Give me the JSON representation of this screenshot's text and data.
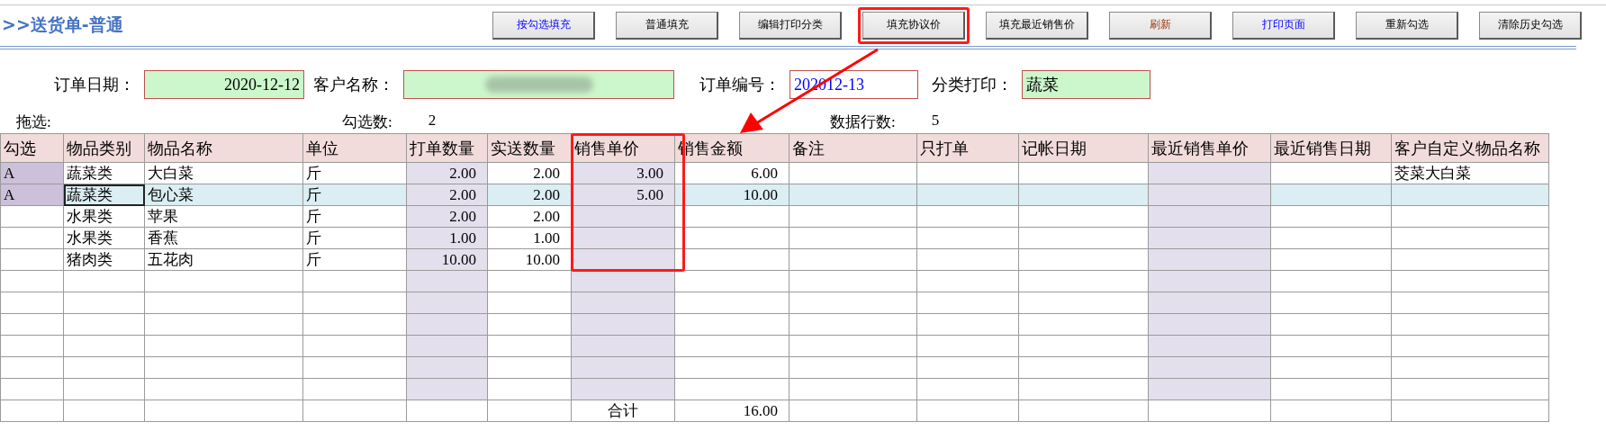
{
  "title": ">>送货单-普通",
  "buttons": [
    {
      "label": "按勾选填充",
      "kind": "link",
      "highlighted": false
    },
    {
      "label": "普通填充",
      "kind": "plain",
      "highlighted": false
    },
    {
      "label": "编辑打印分类",
      "kind": "plain",
      "highlighted": false
    },
    {
      "label": "填充协议价",
      "kind": "plain",
      "highlighted": true
    },
    {
      "label": "填充最近销售价",
      "kind": "plain",
      "highlighted": false
    },
    {
      "label": "刷新",
      "kind": "warning",
      "highlighted": false
    },
    {
      "label": "打印页面",
      "kind": "link",
      "highlighted": false
    },
    {
      "label": "重新勾选",
      "kind": "plain",
      "highlighted": false
    },
    {
      "label": "清除历史勾选",
      "kind": "plain",
      "highlighted": false
    }
  ],
  "fields": [
    {
      "label": "订单日期：",
      "kind": "date",
      "value": "2020-12-12"
    },
    {
      "label": "客户名称：",
      "kind": "blurred",
      "value_blurred": true
    },
    {
      "label": "订单编号：",
      "kind": "code",
      "value": "202012-13"
    },
    {
      "label": "分类打印：",
      "kind": "text",
      "value": "蔬菜"
    }
  ],
  "summary": [
    {
      "label": "拖选:"
    },
    {
      "label": "勾选数:",
      "value": "2"
    },
    {
      "label": "数据行数:",
      "value": "5"
    }
  ],
  "table": {
    "columns": [
      {
        "label": "勾选",
        "kind": "check",
        "shaded": false,
        "highlighted": false
      },
      {
        "label": "物品类别",
        "kind": "text",
        "shaded": false,
        "highlighted": false
      },
      {
        "label": "物品名称",
        "kind": "text",
        "shaded": false,
        "highlighted": false
      },
      {
        "label": "单位",
        "kind": "text",
        "shaded": false,
        "highlighted": false
      },
      {
        "label": "打单数量",
        "kind": "number",
        "shaded": true,
        "highlighted": false
      },
      {
        "label": "实送数量",
        "kind": "number",
        "shaded": false,
        "highlighted": false
      },
      {
        "label": "销售单价",
        "kind": "number",
        "shaded": true,
        "highlighted": true
      },
      {
        "label": "销售金额",
        "kind": "number",
        "shaded": false,
        "highlighted": false
      },
      {
        "label": "备注",
        "kind": "text",
        "shaded": false,
        "highlighted": false
      },
      {
        "label": "只打单",
        "kind": "text",
        "shaded": false,
        "highlighted": false
      },
      {
        "label": "记帐日期",
        "kind": "text",
        "shaded": false,
        "highlighted": false
      },
      {
        "label": "最近销售单价",
        "kind": "number",
        "shaded": true,
        "highlighted": false
      },
      {
        "label": "最近销售日期",
        "kind": "text",
        "shaded": false,
        "highlighted": false
      },
      {
        "label": "客户自定义物品名称",
        "kind": "text",
        "shaded": false,
        "highlighted": false
      }
    ],
    "rows": [
      {
        "checked": true,
        "selected": false,
        "cells": [
          "A",
          "蔬菜类",
          "大白菜",
          "斤",
          "2.00",
          "2.00",
          "3.00",
          "6.00",
          null,
          null,
          null,
          null,
          null,
          "茭菜大白菜"
        ]
      },
      {
        "checked": true,
        "selected": true,
        "cells": [
          "A",
          {
            "text": "蔬菜类",
            "focused": true
          },
          "包心菜",
          "斤",
          "2.00",
          "2.00",
          "5.00",
          "10.00",
          null,
          null,
          null,
          null,
          null,
          null
        ]
      },
      {
        "checked": false,
        "selected": false,
        "cells": [
          null,
          "水果类",
          "苹果",
          "斤",
          "2.00",
          "2.00",
          null,
          null,
          null,
          null,
          null,
          null,
          null,
          null
        ]
      },
      {
        "checked": false,
        "selected": false,
        "cells": [
          null,
          "水果类",
          "香蕉",
          "斤",
          "1.00",
          "1.00",
          null,
          null,
          null,
          null,
          null,
          null,
          null,
          null
        ]
      },
      {
        "checked": false,
        "selected": false,
        "cells": [
          null,
          "猪肉类",
          "五花肉",
          "斤",
          "10.00",
          "10.00",
          null,
          null,
          null,
          null,
          null,
          null,
          null,
          null
        ]
      },
      {
        "checked": false,
        "selected": false
      },
      {
        "checked": false,
        "selected": false
      },
      {
        "checked": false,
        "selected": false
      },
      {
        "checked": false,
        "selected": false
      },
      {
        "checked": false,
        "selected": false
      },
      {
        "checked": false,
        "selected": false
      }
    ],
    "total": {
      "label": "合计",
      "value": "16.00"
    }
  },
  "annotation_arrow": true
}
